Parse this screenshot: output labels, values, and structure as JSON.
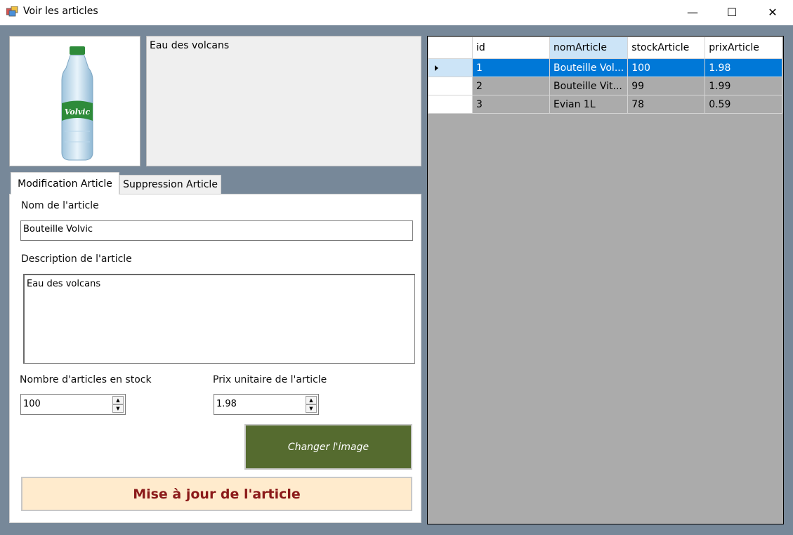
{
  "window": {
    "title": "Voir les articles",
    "icon": "app-window-icon",
    "minimize_glyph": "—",
    "maximize_glyph": "☐",
    "close_glyph": "✕"
  },
  "preview": {
    "image_alt": "Volvic bottle",
    "image_label": "Volvic",
    "description": "Eau des volcans"
  },
  "tabs": [
    {
      "label": "Modification Article",
      "active": true
    },
    {
      "label": "Suppression Article",
      "active": false
    }
  ],
  "form": {
    "name_label": "Nom de l'article",
    "name_value": "Bouteille Volvic",
    "description_label": "Description de l'article",
    "description_value": "Eau des volcans",
    "stock_label": "Nombre d'articles en stock",
    "stock_value": "100",
    "price_label": "Prix unitaire de l'article",
    "price_value": "1.98",
    "change_image_label": "Changer l'image",
    "update_label": "Mise à jour de l'article"
  },
  "grid": {
    "columns": [
      "id",
      "nomArticle",
      "stockArticle",
      "prixArticle"
    ],
    "selected_column": 1,
    "selected_row": 0,
    "rows": [
      [
        "1",
        "Bouteille Vol...",
        "100",
        "1.98"
      ],
      [
        "2",
        "Bouteille Vit...",
        "99",
        "1.99"
      ],
      [
        "3",
        "Evian 1L",
        "78",
        "0.59"
      ]
    ]
  },
  "colors": {
    "background": "#778899",
    "change_button": "#556b2f",
    "update_button": "#ffebcd",
    "update_text": "#8b1a1a",
    "selection": "#0078d7"
  }
}
